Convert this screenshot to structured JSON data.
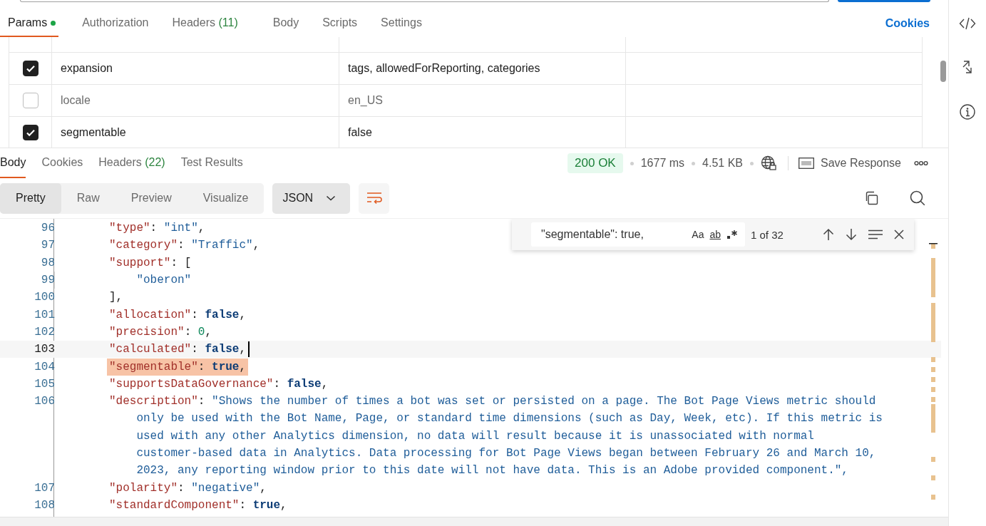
{
  "request_tabs": [
    {
      "label": "Params",
      "dot": true,
      "selected": true
    },
    {
      "label": "Authorization",
      "selected": false
    },
    {
      "label": "Headers",
      "count": "(11)",
      "selected": false
    },
    {
      "label": "Body",
      "selected": false
    },
    {
      "label": "Scripts",
      "selected": false
    },
    {
      "label": "Settings",
      "selected": false
    }
  ],
  "cookies_link": "Cookies",
  "params": [
    {
      "checked": true,
      "key": "expansion",
      "value": "tags, allowedForReporting, categories"
    },
    {
      "checked": false,
      "key": "locale",
      "value": "en_US"
    },
    {
      "checked": true,
      "key": "segmentable",
      "value": "false"
    }
  ],
  "response_tabs": [
    {
      "label": "Body",
      "selected": true
    },
    {
      "label": "Cookies",
      "selected": false
    },
    {
      "label": "Headers",
      "count": "(22)",
      "selected": false
    },
    {
      "label": "Test Results",
      "selected": false
    }
  ],
  "response_meta": {
    "status": "200 OK",
    "time": "1677 ms",
    "size": "4.51 KB",
    "save": "Save Response"
  },
  "view_modes": [
    {
      "label": "Pretty",
      "selected": true
    },
    {
      "label": "Raw",
      "selected": false
    },
    {
      "label": "Preview",
      "selected": false
    },
    {
      "label": "Visualize",
      "selected": false
    }
  ],
  "format": "JSON",
  "find": {
    "value": "\"segmentable\": true,",
    "case_label": "Aa",
    "word_label": "ab",
    "count": "1 of 32"
  },
  "code_lines": [
    {
      "num": "96",
      "tokens": [
        {
          "kind": "key",
          "text": "\"type\""
        },
        {
          "kind": "punct",
          "text": ": "
        },
        {
          "kind": "string",
          "text": "\"int\""
        },
        {
          "kind": "punct",
          "text": ","
        }
      ]
    },
    {
      "num": "97",
      "tokens": [
        {
          "kind": "key",
          "text": "\"category\""
        },
        {
          "kind": "punct",
          "text": ": "
        },
        {
          "kind": "string",
          "text": "\"Traffic\""
        },
        {
          "kind": "punct",
          "text": ","
        }
      ]
    },
    {
      "num": "98",
      "tokens": [
        {
          "kind": "key",
          "text": "\"support\""
        },
        {
          "kind": "punct",
          "text": ": ["
        }
      ],
      "children": [
        {
          "num": "99",
          "tokens": [
            {
              "kind": "string",
              "text": "\"oberon\""
            }
          ]
        }
      ]
    },
    {
      "num": "100",
      "tokens": [
        {
          "kind": "punct",
          "text": "],"
        }
      ]
    },
    {
      "num": "101",
      "tokens": [
        {
          "kind": "key",
          "text": "\"allocation\""
        },
        {
          "kind": "punct",
          "text": ": "
        },
        {
          "kind": "keyword",
          "text": "false"
        },
        {
          "kind": "punct",
          "text": ","
        }
      ]
    },
    {
      "num": "102",
      "tokens": [
        {
          "kind": "key",
          "text": "\"precision\""
        },
        {
          "kind": "punct",
          "text": ": "
        },
        {
          "kind": "number",
          "text": "0"
        },
        {
          "kind": "punct",
          "text": ","
        }
      ]
    },
    {
      "num": "103",
      "current": true,
      "tokens": [
        {
          "kind": "key",
          "text": "\"calculated\""
        },
        {
          "kind": "punct",
          "text": ": "
        },
        {
          "kind": "keyword",
          "text": "false"
        },
        {
          "kind": "punct",
          "text": ","
        }
      ]
    },
    {
      "num": "104",
      "match": true,
      "tokens": [
        {
          "kind": "key",
          "text": "\"segmentable\""
        },
        {
          "kind": "punct",
          "text": ": "
        },
        {
          "kind": "keyword",
          "text": "true"
        },
        {
          "kind": "punct",
          "text": ","
        }
      ]
    },
    {
      "num": "105",
      "tokens": [
        {
          "kind": "key",
          "text": "\"supportsDataGovernance\""
        },
        {
          "kind": "punct",
          "text": ": "
        },
        {
          "kind": "keyword",
          "text": "false"
        },
        {
          "kind": "punct",
          "text": ","
        }
      ]
    },
    {
      "num": "106",
      "tokens": [
        {
          "kind": "key",
          "text": "\"description\""
        },
        {
          "kind": "punct",
          "text": ": "
        },
        {
          "kind": "string",
          "text": "\"Shows the number of times a bot was set or persisted on a page. The Bot Page Views metric should"
        }
      ],
      "wrapped": [
        "only be used with the Bot Name, Page, or standard time dimensions (such as Day, Week, etc). If this metric is",
        "used with any other Analytics dimension, no data will result because it is unassociated with normal",
        "customer-based data in Analytics. Data processing for Bot Page Views began between February 26 and March 10,",
        "2023, any reporting window prior to this date will not have data. This is an Adobe provided component.\","
      ]
    },
    {
      "num": "107",
      "tokens": [
        {
          "kind": "key",
          "text": "\"polarity\""
        },
        {
          "kind": "punct",
          "text": ": "
        },
        {
          "kind": "string",
          "text": "\"negative\""
        },
        {
          "kind": "punct",
          "text": ","
        }
      ]
    },
    {
      "num": "108",
      "tokens": [
        {
          "kind": "key",
          "text": "\"standardComponent\""
        },
        {
          "kind": "punct",
          "text": ": "
        },
        {
          "kind": "keyword",
          "text": "true"
        },
        {
          "kind": "punct",
          "text": ","
        }
      ]
    }
  ]
}
